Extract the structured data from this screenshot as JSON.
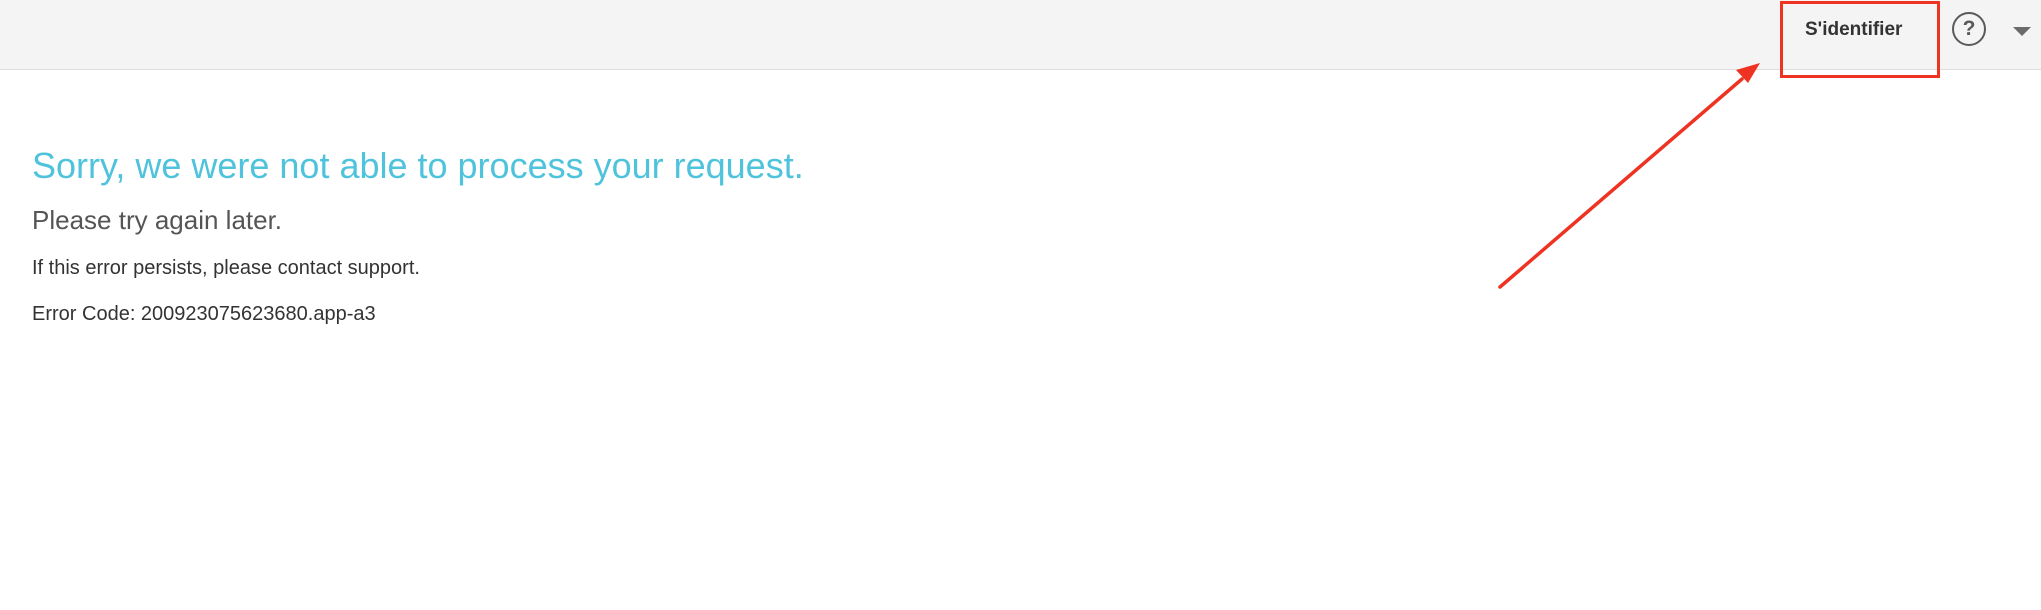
{
  "header": {
    "signin_label": "S'identifier",
    "help_icon": "help-circle-icon",
    "help_glyph": "?",
    "menu_icon": "caret-down-icon"
  },
  "annotation": {
    "color": "#ee3322"
  },
  "error": {
    "title": "Sorry, we were not able to process your request.",
    "subtitle": "Please try again later.",
    "persist_message": "If this error persists, please contact support.",
    "error_code": "Error Code: 200923075623680.app-a3"
  },
  "colors": {
    "title": "#4fc3dc",
    "topbar_bg": "#f4f4f4"
  }
}
